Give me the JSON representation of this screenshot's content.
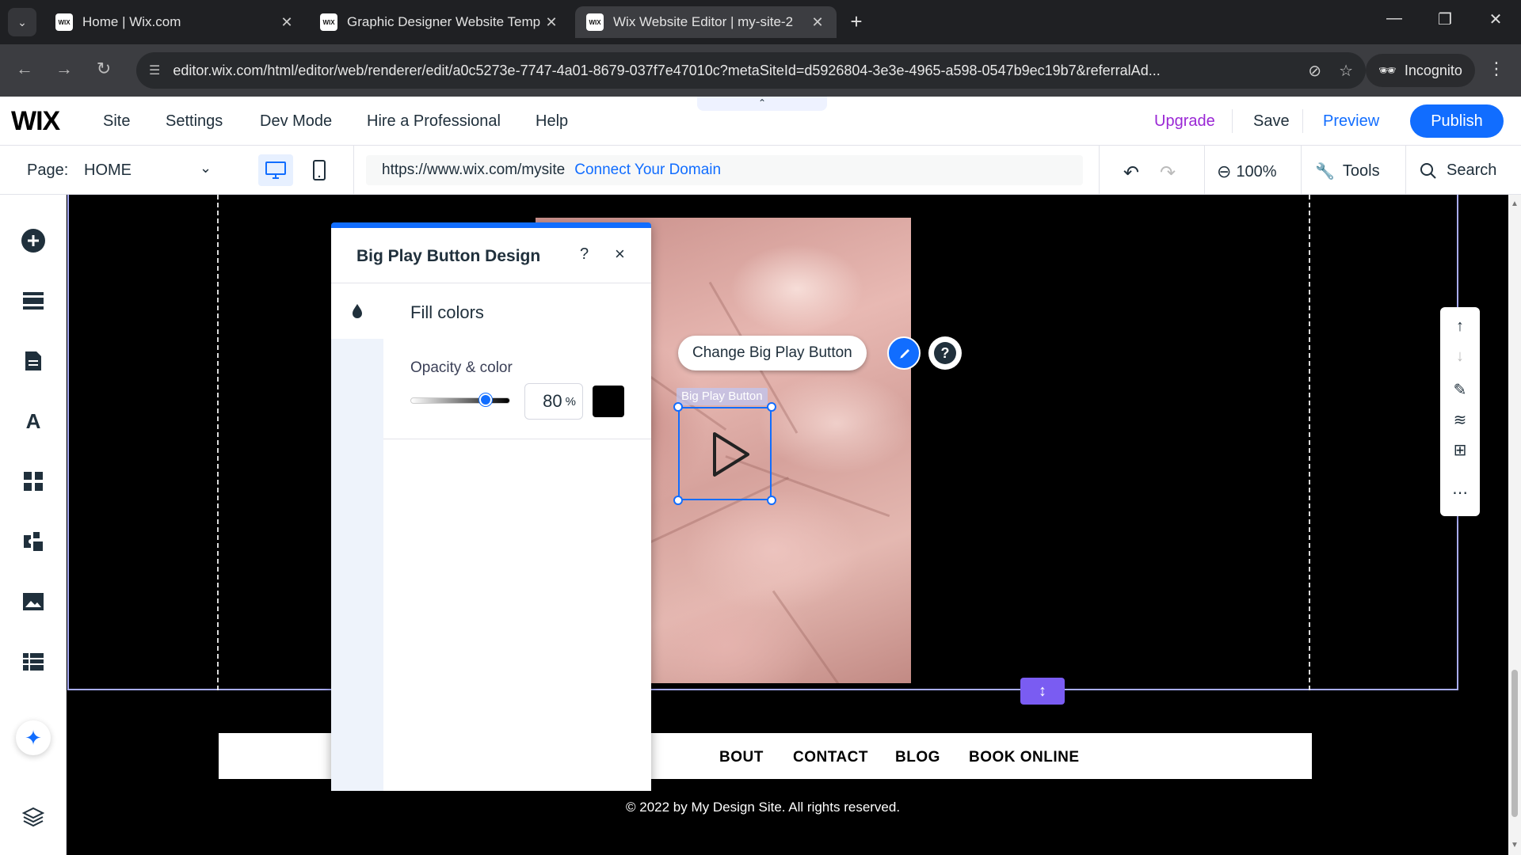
{
  "browser": {
    "tabs": [
      {
        "title": "Home | Wix.com",
        "favicon": "WIX",
        "active": false
      },
      {
        "title": "Graphic Designer Website Temp",
        "favicon": "WIX",
        "active": false
      },
      {
        "title": "Wix Website Editor | my-site-2",
        "favicon": "WIX",
        "active": true
      }
    ],
    "url": "editor.wix.com/html/editor/web/renderer/edit/a0c5273e-7747-4a01-8679-037f7e47010c?metaSiteId=d5926804-3e3e-4965-a598-0547b9ec19b7&referralAd...",
    "incognito_label": "Incognito"
  },
  "wix_bar": {
    "logo": "WIX",
    "menu": [
      "Site",
      "Settings",
      "Dev Mode",
      "Hire a Professional",
      "Help"
    ],
    "upgrade": "Upgrade",
    "save": "Save",
    "preview": "Preview",
    "publish": "Publish"
  },
  "page_bar": {
    "page_label": "Page:",
    "page_name": "HOME",
    "site_url": "https://www.wix.com/mysite",
    "connect_domain": "Connect Your Domain",
    "zoom": "100%",
    "tools": "Tools",
    "search": "Search"
  },
  "design_panel": {
    "title": "Big Play Button Design",
    "help": "?",
    "close": "×",
    "section_title": "Fill colors",
    "opacity_label": "Opacity & color",
    "opacity_value": "80",
    "opacity_unit": "%",
    "opacity_fraction": 0.8,
    "fill_color": "#000000"
  },
  "canvas": {
    "change_button_label": "Change Big Play Button",
    "element_label": "Big Play Button",
    "menu_items": [
      "BOUT",
      "CONTACT",
      "BLOG",
      "BOOK ONLINE"
    ],
    "copyright": "© 2022 by My Design Site. All rights reserved."
  },
  "colors": {
    "accent": "#116dff",
    "upgrade": "#9a27d5",
    "section_handle": "#7a5cf2"
  }
}
